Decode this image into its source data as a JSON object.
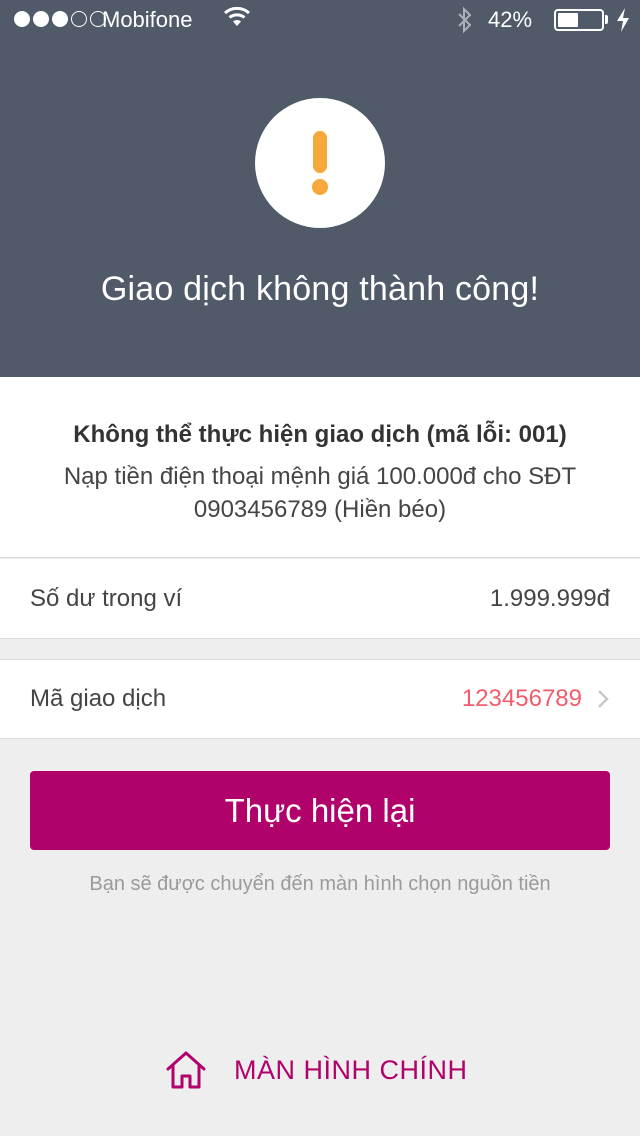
{
  "status_bar": {
    "carrier": "Mobifone",
    "battery_percent": "42%",
    "signal_bars": 3,
    "signal_total": 5
  },
  "header": {
    "title": "Giao dịch không thành công!",
    "icon": "alert-icon",
    "icon_color": "#f6a83a",
    "background_color": "#505a69"
  },
  "message": {
    "title": "Không thể thực hiện giao dịch (mã lỗi: 001)",
    "body": "Nạp tiền điện thoại mệnh giá 100.000đ cho SĐT 0903456789 (Hiền béo)"
  },
  "balance": {
    "label": "Số dư trong ví",
    "value": "1.999.999đ"
  },
  "transaction": {
    "label": "Mã giao dịch",
    "value": "123456789",
    "value_color": "#f25c6c"
  },
  "retry_button": {
    "label": "Thực hiện lại",
    "color": "#b1026c"
  },
  "hint": "Bạn sẽ được chuyển đến màn hình chọn nguồn tiền",
  "home_link": {
    "label": "MÀN HÌNH CHÍNH",
    "icon": "home-icon"
  }
}
